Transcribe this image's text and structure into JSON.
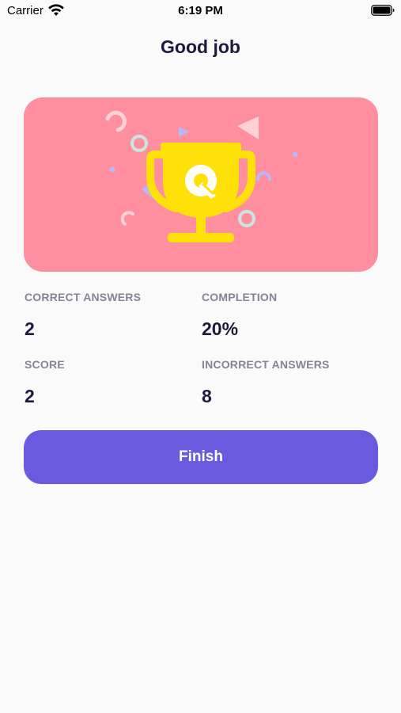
{
  "status_bar": {
    "carrier": "Carrier",
    "time": "6:19 PM"
  },
  "header": {
    "title": "Good job"
  },
  "hero": {
    "icon": "trophy-icon",
    "background_color": "#ff8f9f",
    "trophy_color": "#ffe10a"
  },
  "stats": {
    "correct_answers": {
      "label": "CORRECT ANSWERS",
      "value": "2"
    },
    "completion": {
      "label": "COMPLETION",
      "value": "20%"
    },
    "score": {
      "label": "SCORE",
      "value": "2"
    },
    "incorrect_answers": {
      "label": "INCORRECT ANSWERS",
      "value": "8"
    }
  },
  "actions": {
    "finish_label": "Finish",
    "accent_color": "#6a5ae0"
  }
}
